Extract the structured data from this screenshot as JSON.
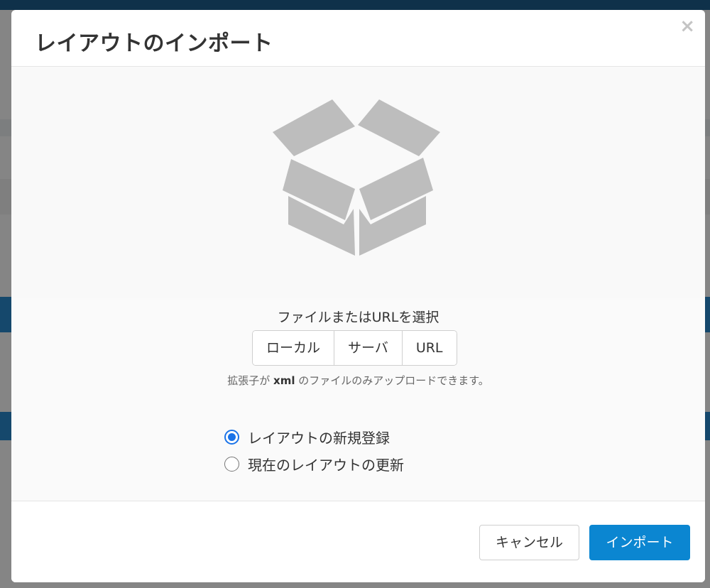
{
  "modal": {
    "title": "レイアウトのインポート",
    "close_glyph": "×"
  },
  "upload": {
    "icon": "box-icon",
    "choose_label": "ファイルまたはURLを選択",
    "sources": [
      {
        "label": "ローカル"
      },
      {
        "label": "サーバ"
      },
      {
        "label": "URL"
      }
    ],
    "note_prefix": "拡張子が",
    "note_ext": "xml",
    "note_suffix": "のファイルのみアップロードできます。"
  },
  "options": [
    {
      "label": "レイアウトの新規登録",
      "checked": true
    },
    {
      "label": "現在のレイアウトの更新",
      "checked": false
    }
  ],
  "footer": {
    "cancel_label": "キャンセル",
    "import_label": "インポート"
  },
  "colors": {
    "primary": "#0b86d1",
    "radio_accent": "#1a73e8",
    "icon_gray": "#bdbdbd"
  }
}
